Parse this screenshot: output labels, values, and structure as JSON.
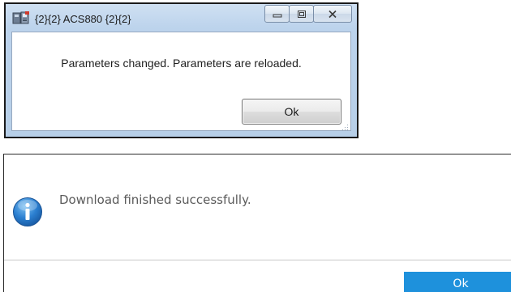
{
  "dialog1": {
    "title": "{2}{2} ACS880 {2}{2}",
    "app_icon": "drive-app-icon",
    "caption_buttons": [
      "minimize-icon",
      "maximize-icon",
      "close-icon"
    ],
    "message": "Parameters changed. Parameters are reloaded.",
    "ok_label": "Ok"
  },
  "dialog2": {
    "icon": "info-icon",
    "message": "Download finished successfully.",
    "ok_label": "Ok",
    "accent_color": "#1e91dc"
  }
}
